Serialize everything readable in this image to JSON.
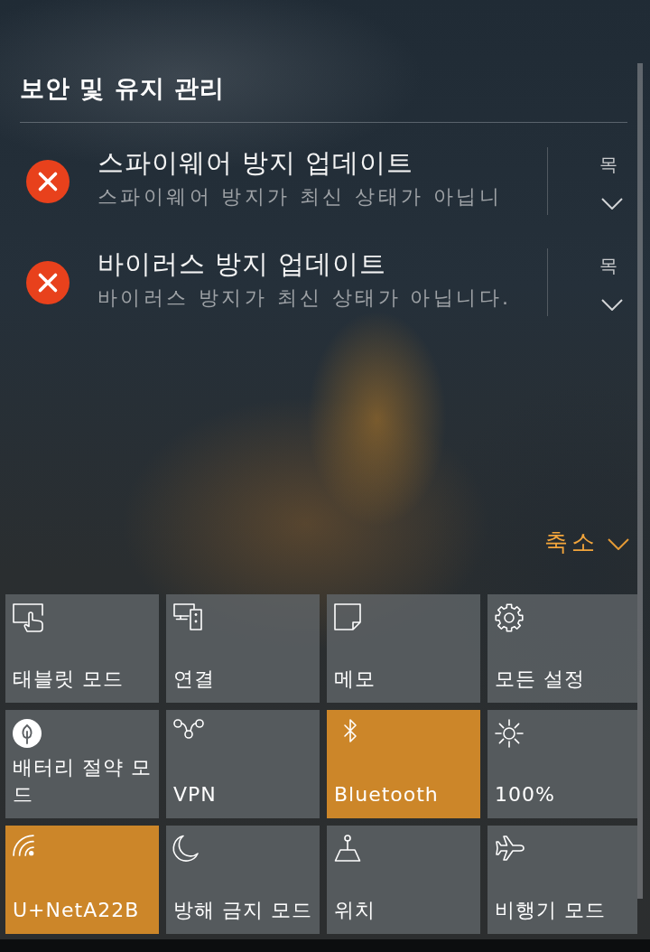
{
  "header": {
    "title": "보안 및 유지 관리"
  },
  "notifications": [
    {
      "title": "스파이웨어 방지 업데이트",
      "body": "스파이웨어 방지가 최신 상태가 아닙니",
      "time": "목"
    },
    {
      "title": "바이러스 방지 업데이트",
      "body": "바이러스 방지가 최신 상태가 아닙니다.",
      "time": "목"
    }
  ],
  "collapse": {
    "label": "축소"
  },
  "quick_actions": [
    {
      "label": "태블릿 모드",
      "on": false
    },
    {
      "label": "연결",
      "on": false
    },
    {
      "label": "메모",
      "on": false
    },
    {
      "label": "모든 설정",
      "on": false
    },
    {
      "label": "배터리 절약 모드",
      "on": false
    },
    {
      "label": "VPN",
      "on": false
    },
    {
      "label": "Bluetooth",
      "on": true
    },
    {
      "label": "100%",
      "on": false
    },
    {
      "label": "U+NetA22B",
      "on": true
    },
    {
      "label": "방해 금지 모드",
      "on": false
    },
    {
      "label": "위치",
      "on": false
    },
    {
      "label": "비행기 모드",
      "on": false
    }
  ]
}
